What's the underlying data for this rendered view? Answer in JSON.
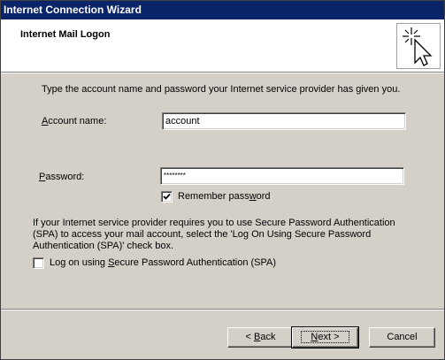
{
  "window": {
    "title": "Internet Connection Wizard"
  },
  "header": {
    "title": "Internet Mail Logon",
    "art_icon": "wizard-wand-cursor-icon"
  },
  "intro_text": "Type the account name and password your Internet service provider has given you.",
  "account": {
    "label_pre": "",
    "label_access": "A",
    "label_post": "ccount name:",
    "value": "account"
  },
  "password": {
    "label_pre": "",
    "label_access": "P",
    "label_post": "assword:",
    "value": "********"
  },
  "remember": {
    "label_pre": "Remember pass",
    "label_access": "w",
    "label_post": "ord",
    "checked": true
  },
  "spa": {
    "description": "If your Internet service provider requires you to use Secure Password Authentication (SPA) to access your mail account, select the 'Log On Using Secure Password Authentication (SPA)' check box.",
    "label_pre": "Log on using ",
    "label_access": "S",
    "label_post": "ecure Password Authentication (SPA)",
    "checked": false
  },
  "buttons": {
    "back_arrow": "<",
    "back_access": "B",
    "back_post": "ack",
    "next_pre": "",
    "next_access": "N",
    "next_post": "ext",
    "next_arrow": ">",
    "cancel": "Cancel"
  }
}
